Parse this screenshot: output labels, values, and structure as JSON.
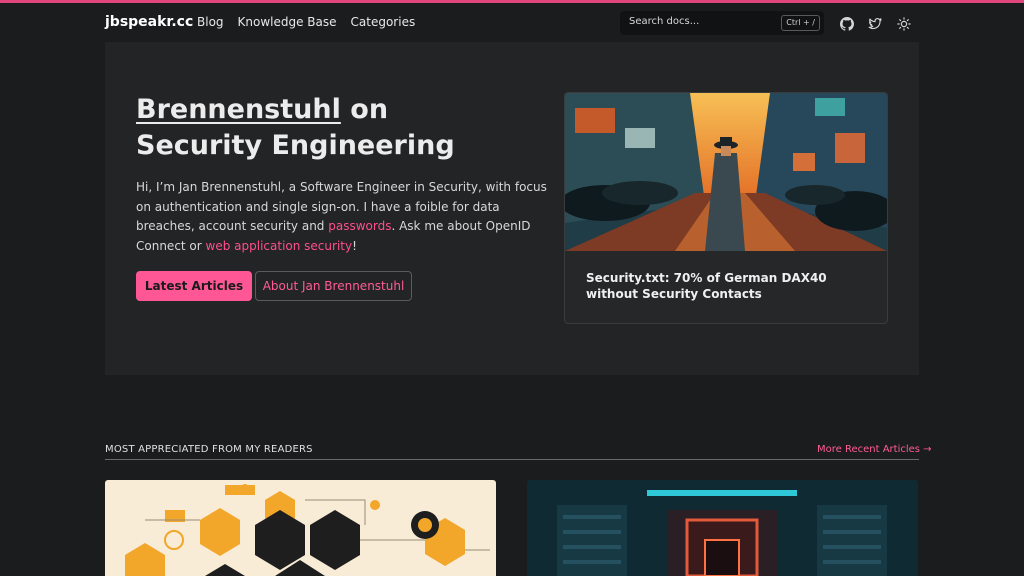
{
  "site": {
    "brand": "jbspeakr.cc",
    "accent": "#ff5795"
  },
  "nav": {
    "items": [
      "Blog",
      "Knowledge Base",
      "Categories"
    ]
  },
  "search": {
    "placeholder": "Search docs...",
    "shortcut": "Ctrl + /"
  },
  "header_icons": [
    "github-icon",
    "twitter-icon",
    "sun-icon"
  ],
  "hero": {
    "title_name": "Brennenstuhl",
    "title_rest": " on Security Engineering",
    "intro_1": "Hi, I’m Jan Brennenstuhl, a Software Engineer in Security, with focus on authentication and single sign-on. I have a foible for data breaches, account security and ",
    "intro_link_1": "passwords",
    "intro_2": ". Ask me about OpenID Connect or ",
    "intro_link_2": "web application security",
    "intro_3": "!",
    "primary_button": "Latest Articles",
    "secondary_button": "About Jan Brennenstuhl"
  },
  "featured": {
    "title": "Security.txt: 70% of German DAX40 without Security Contacts"
  },
  "section": {
    "heading": "MOST APPRECIATED FROM MY READERS",
    "more_link": "More Recent Articles →"
  }
}
